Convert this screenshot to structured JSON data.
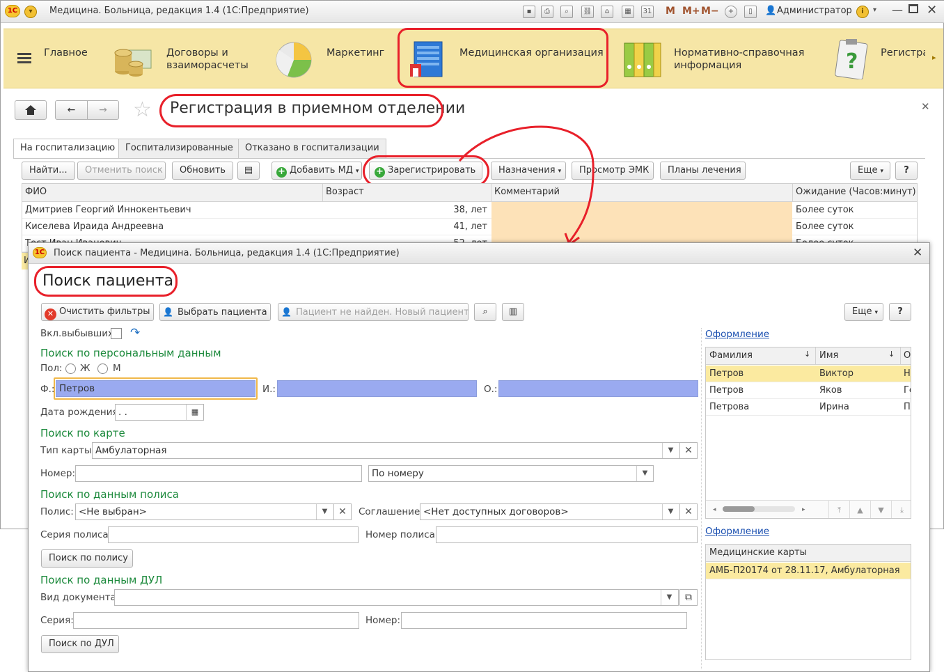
{
  "titlebar": {
    "logo": "1С",
    "title": "Медицина. Больница, редакция 1.4  (1С:Предприятие)",
    "user": "Администратор",
    "m_buttons": [
      "M",
      "M+",
      "M−"
    ]
  },
  "sections": [
    {
      "label_l1": "Главное",
      "label_l2": "",
      "icon": "menu-icon"
    },
    {
      "label_l1": "Договоры и",
      "label_l2": "взаиморасчеты",
      "icon": "coins-icon"
    },
    {
      "label_l1": "Маркетинг",
      "label_l2": "",
      "icon": "pie-chart-icon"
    },
    {
      "label_l1": "Медицинская организация",
      "label_l2": "",
      "icon": "building-icon"
    },
    {
      "label_l1": "Нормативно-справочная",
      "label_l2": "информация",
      "icon": "binders-icon"
    },
    {
      "label_l1": "Регистра",
      "label_l2": "",
      "icon": "clipboard-question-icon"
    }
  ],
  "form": {
    "title": "Регистрация в приемном отделении",
    "tabs": [
      "На госпитализацию",
      "Госпитализированные",
      "Отказано в госпитализации"
    ],
    "toolbar": {
      "find": "Найти...",
      "cancel_search": "Отменить поиск",
      "refresh": "Обновить",
      "add_md": "Добавить МД",
      "register": "Зарегистрировать",
      "assignments": "Назначения",
      "view_emk": "Просмотр ЭМК",
      "treatment_plans": "Планы лечения",
      "more": "Еще",
      "help": "?"
    },
    "columns": [
      "ФИО",
      "Возраст",
      "Комментарий",
      "Ожидание (Часов:минут)"
    ],
    "rows": [
      {
        "name": "Дмитриев Георгий Иннокентьевич",
        "age": "38, лет",
        "comment": "",
        "wait": "Более суток"
      },
      {
        "name": "Киселева Ираида Андреевна",
        "age": "41, лет",
        "comment": "",
        "wait": "Более суток"
      },
      {
        "name": "Тест Иван Иванович",
        "age": "52, лет",
        "comment": "",
        "wait": "Более суток"
      }
    ],
    "row4_stub": "И"
  },
  "dialog": {
    "window_title": "Поиск пациента - Медицина. Больница, редакция 1.4  (1С:Предприятие)",
    "heading": "Поиск пациента",
    "toolbar": {
      "clear_filters": "Очистить фильтры",
      "choose_patient": "Выбрать пациента",
      "new_patient": "Пациент не найден. Новый пациент",
      "more": "Еще",
      "help": "?"
    },
    "include_departed_label": "Вкл.выбывших:",
    "personal": {
      "title": "Поиск по персональным данным",
      "gender_label": "Пол:",
      "gender_f": "Ж",
      "gender_m": "М",
      "last_name_label": "Ф.:",
      "last_name_value": "Петров",
      "first_name_label": "И.:",
      "first_name_value": "",
      "patronymic_label": "О.:",
      "patronymic_value": "",
      "birthdate_label": "Дата рождения:",
      "birthdate_value": " .  ."
    },
    "card": {
      "title": "Поиск по  карте",
      "type_label": "Тип карты:",
      "type_value": "Амбулаторная",
      "number_label": "Номер:",
      "number_value": "",
      "mode_value": "По номеру"
    },
    "policy": {
      "title": "Поиск по данным полиса",
      "policy_label": "Полис:",
      "policy_value": "<Не выбран>",
      "agreement_label": "Соглашение:",
      "agreement_value": "<Нет доступных договоров>",
      "series_label": "Серия полиса:",
      "series_value": "",
      "number_label": "Номер полиса:",
      "number_value": "",
      "search_button": "Поиск по полису"
    },
    "dul": {
      "title": "Поиск по данным ДУЛ",
      "doc_type_label": "Вид документа:",
      "doc_type_value": "",
      "series_label": "Серия:",
      "series_value": "",
      "number_label": "Номер:",
      "number_value": "",
      "search_button": "Поиск по ДУЛ"
    },
    "results": {
      "appearance_link": "Оформление",
      "columns": [
        "Фамилия",
        "Имя",
        "О"
      ],
      "rows": [
        {
          "last": "Петров",
          "first": "Виктор",
          "mid": "Н"
        },
        {
          "last": "Петров",
          "first": "Яков",
          "mid": "Ге"
        },
        {
          "last": "Петрова",
          "first": "Ирина",
          "mid": "П"
        }
      ]
    },
    "cards": {
      "appearance_link": "Оформление",
      "column": "Медицинские карты",
      "rows": [
        "АМБ-П20174 от 28.11.17, Амбулаторная"
      ]
    }
  },
  "colors": {
    "sections_bg": "#f6e6a6",
    "annotation_red": "#e8202a",
    "group_green": "#1c8a3c",
    "selected_row": "#fbeaa0",
    "comment_cell": "#fde2b8",
    "filled_field": "#9aaaf0"
  }
}
